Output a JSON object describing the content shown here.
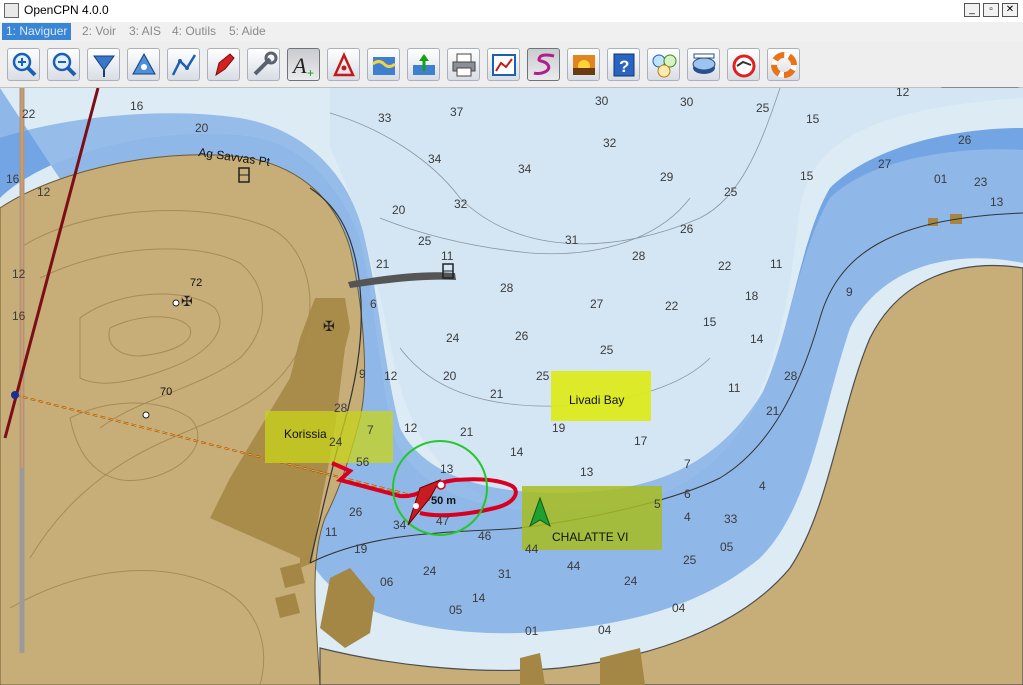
{
  "window": {
    "title": "OpenCPN 4.0.0",
    "minimize": "_",
    "maximize": "▫",
    "close": "✕"
  },
  "menu": [
    {
      "label": "1: Naviguer",
      "active": true
    },
    {
      "label": "2: Voir"
    },
    {
      "label": "3: AIS"
    },
    {
      "label": "4: Outils"
    },
    {
      "label": "5: Aide"
    }
  ],
  "toolbar": [
    "zoom-in-icon",
    "zoom-out-icon",
    "drop-marker-icon",
    "north-up-icon",
    "route-icon",
    "follow-ship-icon",
    "settings-icon",
    "text-icon",
    "ais-icon",
    "tides-icon",
    "currents-icon",
    "print-icon",
    "route-manager-icon",
    "track-icon",
    "color-scheme-icon",
    "help-icon",
    "dashboard-icon",
    "ocpn-draw-icon",
    "watchdog-icon",
    "lifebuoy-icon"
  ],
  "chart": {
    "place_labels": {
      "ag_savvas": "Ag Savvas Pt",
      "korissia": "Korissia",
      "livadi_bay": "Livadi Bay",
      "vessel": "CHALATTE VI",
      "range_ring": "50 m"
    },
    "spot_heights": {
      "h72": "72",
      "h70": "70"
    },
    "soundings": [
      "22",
      "12",
      "16",
      "12",
      "16",
      "16",
      "20",
      "20",
      "37",
      "30",
      "25",
      "33",
      "32",
      "34",
      "34",
      "29",
      "32",
      "25",
      "31",
      "30",
      "25",
      "21",
      "11",
      "28",
      "26",
      "28",
      "22",
      "11",
      "24",
      "26",
      "27",
      "25",
      "22",
      "14",
      "20",
      "21",
      "15",
      "19",
      "17",
      "13",
      "14",
      "25",
      "11",
      "21",
      "12",
      "13",
      "6",
      "9",
      "12",
      "24",
      "28",
      "28",
      "56",
      "26",
      "11",
      "19",
      "34",
      "47",
      "46",
      "24",
      "31",
      "44",
      "44",
      "24",
      "4",
      "33",
      "25",
      "05",
      "06",
      "05",
      "14",
      "01",
      "04",
      "04",
      "7",
      "5",
      "6",
      "4",
      "7",
      "18",
      "9",
      "13",
      "23",
      "01",
      "26",
      "27",
      "15",
      "12",
      "15",
      "21"
    ],
    "colors": {
      "land": "#c7ad78",
      "deep": "#dcebf4",
      "shallow": "#8fb8e8",
      "drying": "#5c96e0",
      "built": "#a58745",
      "track": "#d8001e",
      "highlight": "#dcea1e"
    }
  }
}
